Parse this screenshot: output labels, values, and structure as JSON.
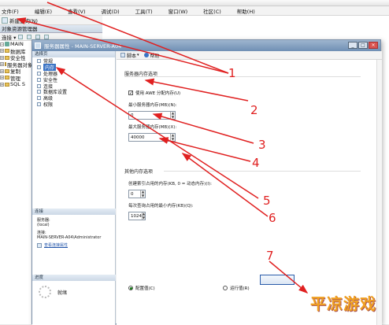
{
  "ssms": {
    "title_text": "",
    "menu": [
      "文件(F)",
      "编辑(E)",
      "查看(V)",
      "调试(D)",
      "工具(T)",
      "窗口(W)",
      "社区(C)",
      "帮助(H)"
    ],
    "new_query_label": "新建查询(N)",
    "object_explorer_title": "对象资源管理器",
    "object_explorer_connect": "连接 ▾",
    "tree": [
      {
        "label": "MAIN",
        "type": "server"
      },
      {
        "label": "数据库",
        "type": "folder"
      },
      {
        "label": "安全性",
        "type": "folder"
      },
      {
        "label": "服务器对象",
        "type": "folder"
      },
      {
        "label": "复制",
        "type": "folder"
      },
      {
        "label": "管理",
        "type": "folder"
      },
      {
        "label": "SQL S",
        "type": "folder"
      }
    ]
  },
  "dialog": {
    "title": "服务器属性 - MAIN-SERVER-A04",
    "select_page_label": "选择页",
    "pages": [
      "常规",
      "内存",
      "处理器",
      "安全性",
      "连接",
      "数据库设置",
      "高级",
      "权限"
    ],
    "selected_page": "内存",
    "toolbar": {
      "script_label": "脚本",
      "help_label": "帮助"
    },
    "memory_section_title": "服务器内存选项",
    "awe_checkbox_label": "使用 AWE 分配内存(U)",
    "awe_checked": true,
    "min_memory_label": "最小服务器内存(MB)(N):",
    "min_memory_value": "0",
    "max_memory_label": "最大服务器内存(MB)(X):",
    "max_memory_value": "40000",
    "other_section_title": "其他内存选项",
    "index_memory_label": "创建索引占用的内存(KB, 0 = 动态内存)(I):",
    "index_memory_value": "0",
    "query_memory_label": "每次查询占用的最小内存(KB)(Q):",
    "query_memory_value": "1024",
    "config_radio_label": "配置值(C)",
    "running_radio_label": "运行值(R)",
    "config_selected": true,
    "connection_header": "连接",
    "connection_server_label": "服务器:",
    "connection_server_value": "(local)",
    "connection_conn_label": "连接:",
    "connection_conn_value": "MAIN-SERVER-A04\\Administrator",
    "view_connection_link": "查看连接属性",
    "progress_header": "进度",
    "progress_status": "就绪",
    "ok_label": ""
  },
  "annotations": {
    "color": "#e02020",
    "numbers": [
      "1",
      "2",
      "3",
      "4",
      "5",
      "6",
      "7"
    ]
  },
  "watermark": "平凉游戏"
}
